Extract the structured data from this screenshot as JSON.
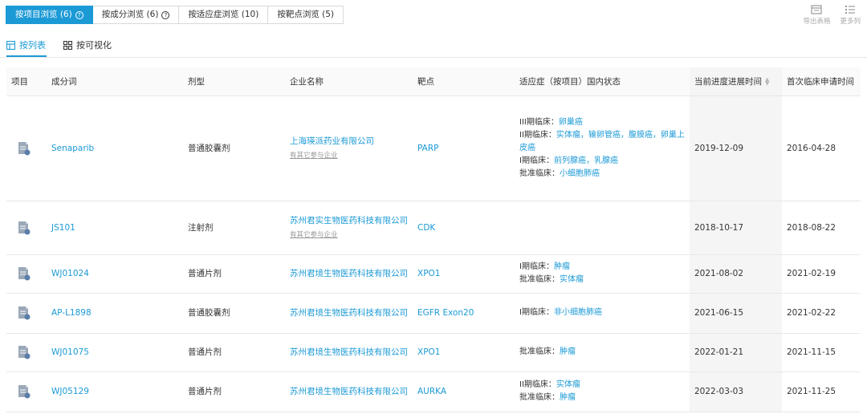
{
  "tabs": [
    {
      "label": "按项目浏览 (6)",
      "help": true,
      "active": true
    },
    {
      "label": "按成分浏览 (6)",
      "help": true,
      "active": false
    },
    {
      "label": "按适应症浏览 (10)",
      "help": false,
      "active": false
    },
    {
      "label": "按靶点浏览 (5)",
      "help": false,
      "active": false
    }
  ],
  "toolbar": {
    "export_label": "导出表格",
    "more_columns_label": "更多列"
  },
  "view_switch": {
    "list_label": "按列表",
    "visual_label": "按可视化"
  },
  "table": {
    "headers": {
      "project": "项目",
      "ingredient": "成分词",
      "dosage_form": "剂型",
      "company": "企业名称",
      "target": "靶点",
      "indication": "适应症（按项目）国内状态",
      "progress_date": "当前进度进展时间",
      "first_apply_date": "首次临床申请时间"
    },
    "rows": [
      {
        "ingredient": "Senaparib",
        "dosage_form": "普通胶囊剂",
        "company": "上海瑛派药业有限公司",
        "company_sub": "有其它参与企业",
        "target": "PARP",
        "indications": [
          {
            "label": "III期临床：",
            "value": "卵巢癌"
          },
          {
            "label": "II期临床：",
            "value": "实体瘤，输卵管癌，腹膜癌，卵巢上皮癌"
          },
          {
            "label": "I期临床：",
            "value": "前列腺癌，乳腺癌"
          },
          {
            "label": "批准临床：",
            "value": "小细胞肺癌"
          }
        ],
        "progress_date": "2019-12-09",
        "first_apply_date": "2016-04-28"
      },
      {
        "ingredient": "JS101",
        "dosage_form": "注射剂",
        "company": "苏州君实生物医药科技有限公司",
        "company_sub": "有其它参与企业",
        "target": "CDK",
        "indications": [],
        "progress_date": "2018-10-17",
        "first_apply_date": "2018-08-22"
      },
      {
        "ingredient": "WJ01024",
        "dosage_form": "普通片剂",
        "company": "苏州君境生物医药科技有限公司",
        "company_sub": "",
        "target": "XPO1",
        "indications": [
          {
            "label": "I期临床：",
            "value": "肿瘤"
          },
          {
            "label": "批准临床：",
            "value": "实体瘤"
          }
        ],
        "progress_date": "2021-08-02",
        "first_apply_date": "2021-02-19"
      },
      {
        "ingredient": "AP-L1898",
        "dosage_form": "普通胶囊剂",
        "company": "苏州君境生物医药科技有限公司",
        "company_sub": "",
        "target": "EGFR Exon20",
        "indications": [
          {
            "label": "I期临床：",
            "value": "非小细胞肺癌"
          }
        ],
        "progress_date": "2021-06-15",
        "first_apply_date": "2021-02-22"
      },
      {
        "ingredient": "WJ01075",
        "dosage_form": "普通片剂",
        "company": "苏州君境生物医药科技有限公司",
        "company_sub": "",
        "target": "XPO1",
        "indications": [
          {
            "label": "批准临床：",
            "value": "肿瘤"
          }
        ],
        "progress_date": "2022-01-21",
        "first_apply_date": "2021-11-15"
      },
      {
        "ingredient": "WJ05129",
        "dosage_form": "普通片剂",
        "company": "苏州君境生物医药科技有限公司",
        "company_sub": "",
        "target": "AURKA",
        "indications": [
          {
            "label": "II期临床：",
            "value": "实体瘤"
          },
          {
            "label": "批准临床：",
            "value": "肿瘤"
          }
        ],
        "progress_date": "2022-03-03",
        "first_apply_date": "2021-11-25"
      }
    ]
  },
  "colors": {
    "accent": "#1c9ad6",
    "header_bg": "#fafafa",
    "border": "#e8e8e8"
  }
}
